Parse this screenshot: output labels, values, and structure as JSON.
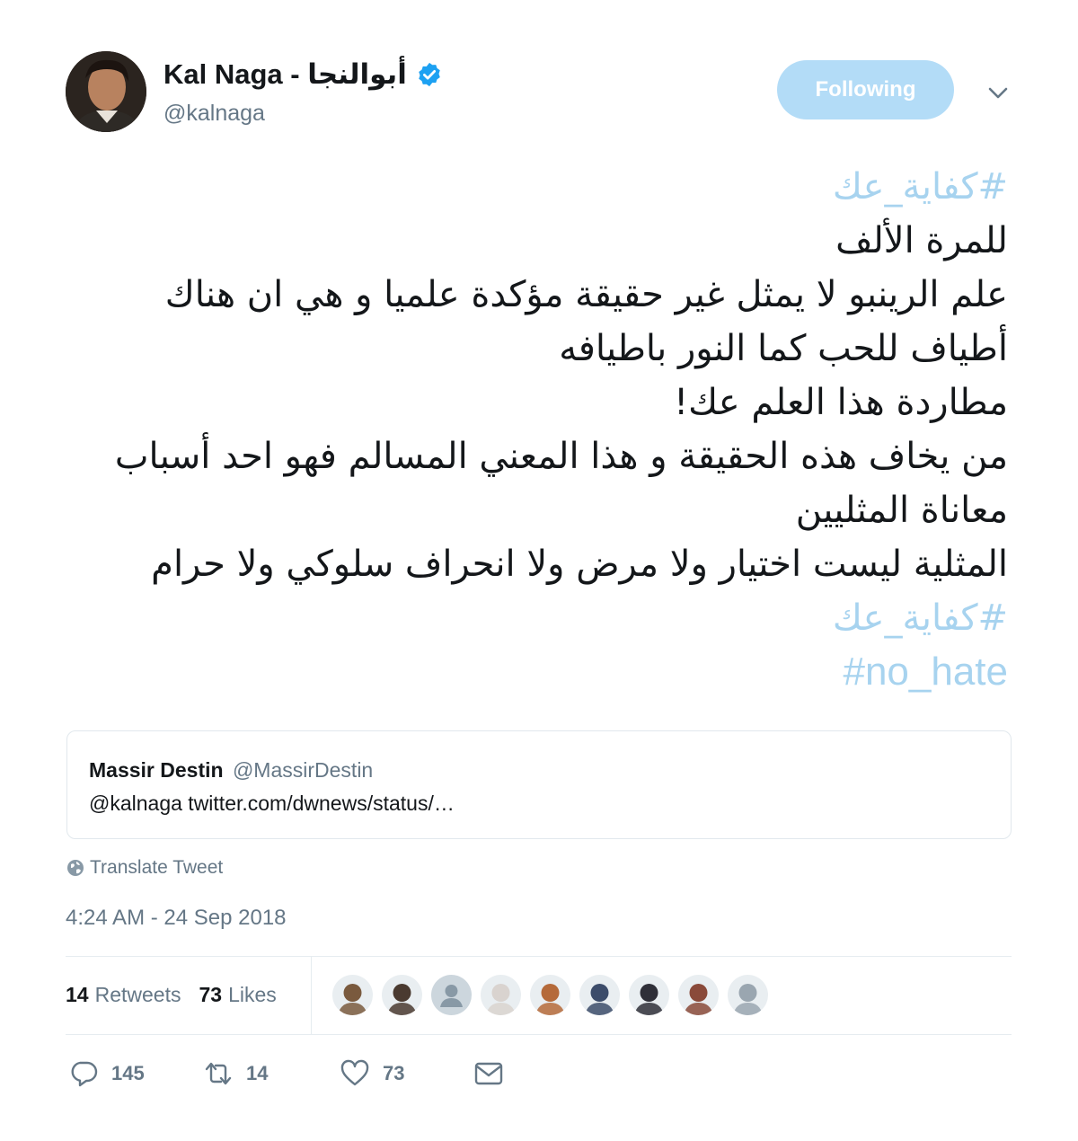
{
  "author": {
    "display_name": "Kal Naga - أبوالنجا",
    "handle": "@kalnaga"
  },
  "follow_button": {
    "label": "Following"
  },
  "tweet_lines": [
    {
      "text": "#كفاية_عك",
      "kind": "hashtag"
    },
    {
      "text": "للمرة الألف",
      "kind": "text"
    },
    {
      "text": "علم الرينبو لا يمثل غير حقيقة مؤكدة علميا و هي ان هناك",
      "kind": "text"
    },
    {
      "text": "أطياف للحب كما النور باطيافه",
      "kind": "text"
    },
    {
      "text": "مطاردة هذا العلم عك!",
      "kind": "text"
    },
    {
      "text": "من يخاف هذه الحقيقة و هذا المعني المسالم فهو احد أسباب",
      "kind": "text"
    },
    {
      "text": "معاناة المثليين",
      "kind": "text"
    },
    {
      "text": "المثلية ليست اختيار ولا مرض ولا انحراف سلوكي ولا حرام",
      "kind": "text"
    },
    {
      "text": "#كفاية_عك",
      "kind": "hashtag"
    },
    {
      "text": "#no_hate",
      "kind": "hashtag-latin"
    }
  ],
  "quoted_tweet": {
    "name": "Massir Destin",
    "handle": "@MassirDestin",
    "text": "@kalnaga twitter.com/dwnews/status/…"
  },
  "translate_label": "Translate Tweet",
  "timestamp": "4:24 AM - 24 Sep 2018",
  "stats": {
    "retweets_count": "14",
    "retweets_label": "Retweets",
    "likes_count": "73",
    "likes_label": "Likes"
  },
  "likers": [
    {
      "icon": "avatar",
      "color": "#7a5a3e"
    },
    {
      "icon": "avatar",
      "color": "#4a3a30"
    },
    {
      "icon": "default-avatar",
      "color": "#ccd6dd"
    },
    {
      "icon": "avatar",
      "color": "#d9d3cf"
    },
    {
      "icon": "avatar",
      "color": "#b56a3a"
    },
    {
      "icon": "avatar",
      "color": "#3c4c6a"
    },
    {
      "icon": "avatar",
      "color": "#2f2f38"
    },
    {
      "icon": "avatar",
      "color": "#8a4a3a"
    },
    {
      "icon": "avatar",
      "color": "#9aa6b0"
    }
  ],
  "actions": {
    "replies": "145",
    "retweets": "14",
    "likes": "73"
  },
  "colors": {
    "hashtag": "#a7d3ef",
    "follow_button_bg": "#b3dcf7",
    "verified": "#1da1f2",
    "secondary_text": "#657786"
  }
}
